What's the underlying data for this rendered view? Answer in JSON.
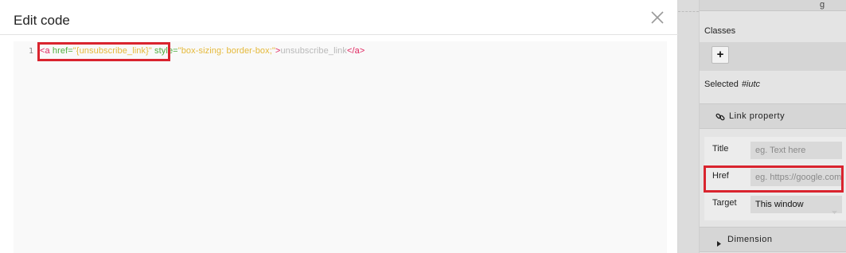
{
  "modal": {
    "title": "Edit code",
    "close_icon": "close-icon"
  },
  "code": {
    "line_number": "1",
    "tokens": {
      "open_tag": "<a ",
      "href_attr": "href",
      "eq1": "=",
      "href_val": "\"{unsubscribe_link}\"",
      "space": " ",
      "style_attr": "style",
      "eq2": "=",
      "style_val": "\"box-sizing: border-box;\"",
      "close_bracket": ">",
      "text": "unsubscribe_link",
      "end_tag": "</a>"
    }
  },
  "panel": {
    "classes_label": "Classes",
    "add_label": "+",
    "selected_label": "Selected",
    "selected_id": "#iutc",
    "link_section_label": "Link property",
    "dimension_label": "Dimension",
    "title_label": "Title",
    "title_placeholder": "eg. Text here",
    "href_label": "Href",
    "href_placeholder": "eg. https://google.com",
    "target_label": "Target",
    "target_value": "This window",
    "corner_glyph": "g"
  },
  "colors": {
    "highlight": "#d9242e",
    "tag": "#e0245e",
    "attr": "#4fae3e",
    "value": "#e5b93a"
  }
}
